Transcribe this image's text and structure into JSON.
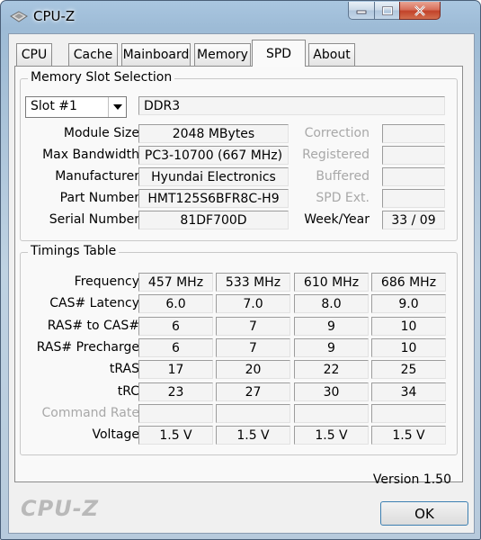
{
  "window": {
    "title": "CPU-Z"
  },
  "tabs": [
    "CPU",
    "Cache",
    "Mainboard",
    "Memory",
    "SPD",
    "About"
  ],
  "active_tab": "SPD",
  "memory_slot": {
    "group_label": "Memory Slot Selection",
    "slot_value": "Slot #1",
    "type": "DDR3",
    "module_size_label": "Module Size",
    "module_size": "2048 MBytes",
    "max_bandwidth_label": "Max Bandwidth",
    "max_bandwidth": "PC3-10700 (667 MHz)",
    "manufacturer_label": "Manufacturer",
    "manufacturer": "Hyundai Electronics",
    "part_number_label": "Part Number",
    "part_number": "HMT125S6BFR8C-H9",
    "serial_number_label": "Serial Number",
    "serial_number": "81DF700D",
    "correction_label": "Correction",
    "registered_label": "Registered",
    "buffered_label": "Buffered",
    "spd_ext_label": "SPD Ext.",
    "week_year_label": "Week/Year",
    "week_year": "33 / 09"
  },
  "timings": {
    "group_label": "Timings Table",
    "rows": [
      {
        "label": "Frequency",
        "values": [
          "457 MHz",
          "533 MHz",
          "610 MHz",
          "686 MHz"
        ],
        "disabled": false
      },
      {
        "label": "CAS# Latency",
        "values": [
          "6.0",
          "7.0",
          "8.0",
          "9.0"
        ],
        "disabled": false
      },
      {
        "label": "RAS# to CAS#",
        "values": [
          "6",
          "7",
          "9",
          "10"
        ],
        "disabled": false
      },
      {
        "label": "RAS# Precharge",
        "values": [
          "6",
          "7",
          "9",
          "10"
        ],
        "disabled": false
      },
      {
        "label": "tRAS",
        "values": [
          "17",
          "20",
          "22",
          "25"
        ],
        "disabled": false
      },
      {
        "label": "tRC",
        "values": [
          "23",
          "27",
          "30",
          "34"
        ],
        "disabled": false
      },
      {
        "label": "Command Rate",
        "values": [
          "",
          "",
          "",
          ""
        ],
        "disabled": true
      },
      {
        "label": "Voltage",
        "values": [
          "1.5 V",
          "1.5 V",
          "1.5 V",
          "1.5 V"
        ],
        "disabled": false
      }
    ]
  },
  "version": "Version 1.50",
  "footer": {
    "logo": "CPU-Z",
    "ok_label": "OK"
  }
}
